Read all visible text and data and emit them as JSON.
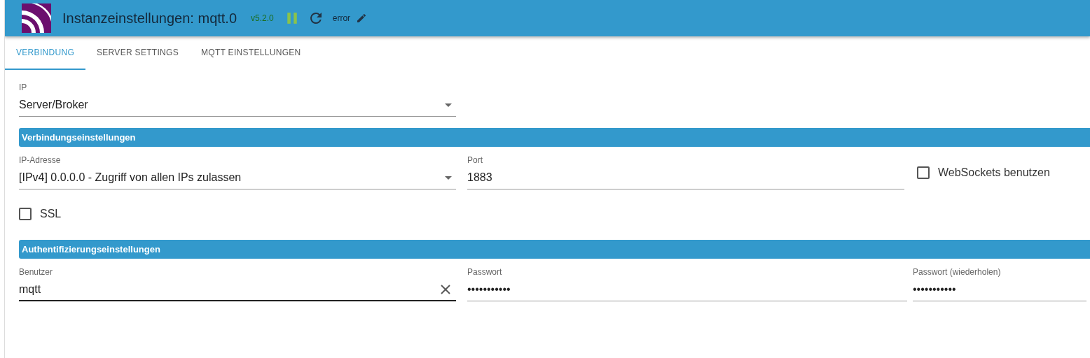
{
  "header": {
    "title": "Instanzeinstellungen: mqtt.0",
    "version": "v5.2.0",
    "status": "error"
  },
  "tabs": [
    {
      "label": "VERBINDUNG",
      "selected": true
    },
    {
      "label": "SERVER SETTINGS",
      "selected": false
    },
    {
      "label": "MQTT EINSTELLUNGEN",
      "selected": false
    }
  ],
  "ip_select": {
    "label": "IP",
    "value": "Server/Broker"
  },
  "sections": [
    {
      "title": "Verbindungseinstellungen",
      "fields": [
        {
          "kind": "select",
          "label": "IP-Adresse",
          "value": "[IPv4] 0.0.0.0 - Zugriff von allen IPs zulassen"
        },
        {
          "kind": "text",
          "label": "Port",
          "value": "1883"
        },
        {
          "kind": "checkbox",
          "label": "WebSockets benutzen",
          "checked": false
        }
      ],
      "extra": [
        {
          "kind": "checkbox",
          "label": "SSL",
          "checked": false
        }
      ]
    },
    {
      "title": "Authentifizierungseinstellungen",
      "fields": [
        {
          "kind": "text",
          "label": "Benutzer",
          "value": "mqtt",
          "clearable": true,
          "focused": true
        },
        {
          "kind": "text",
          "label": "Passwort",
          "value": "•••••••••••"
        },
        {
          "kind": "text",
          "label": "Passwort (wiederholen)",
          "value": "•••••••••••"
        }
      ]
    }
  ]
}
